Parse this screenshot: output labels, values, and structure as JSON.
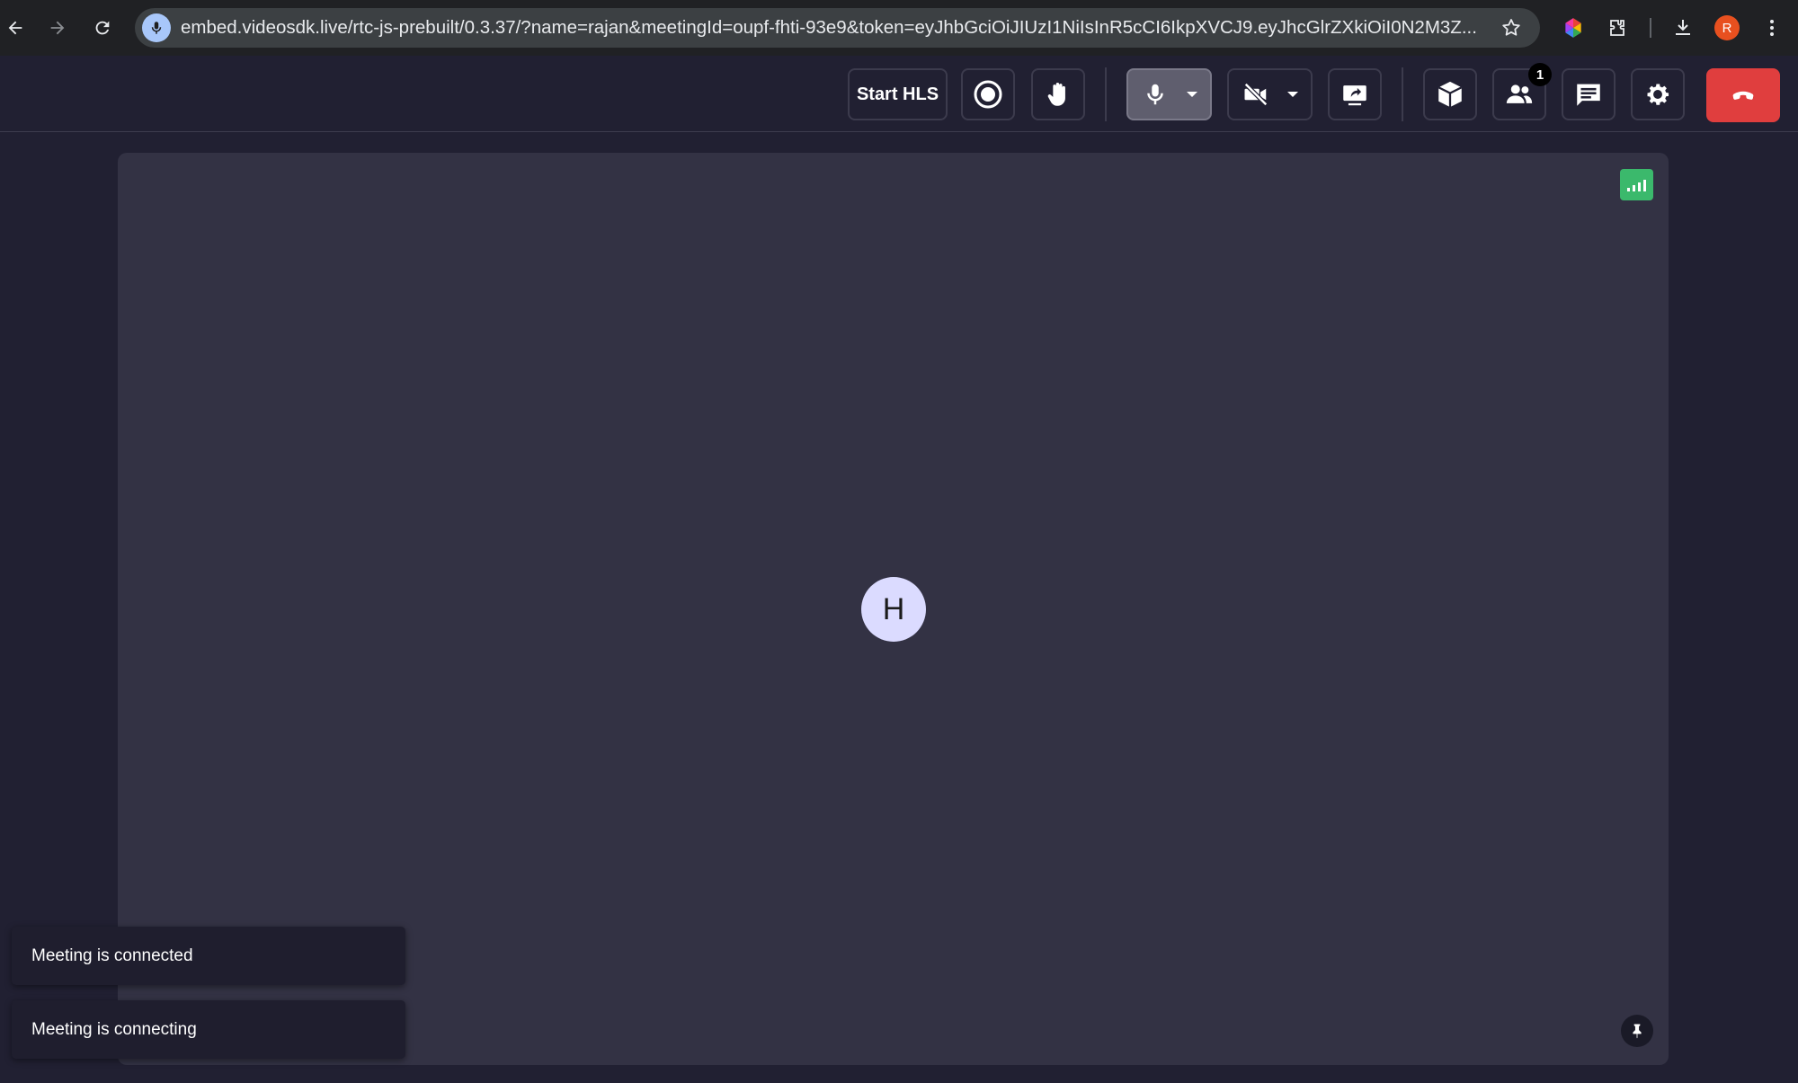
{
  "browser": {
    "url": "embed.videosdk.live/rtc-js-prebuilt/0.3.37/?name=rajan&meetingId=oupf-fhti-93e9&token=eyJhbGciOiJIUzI1NiIsInR5cCI6IkpXVCJ9.eyJhcGlrZXkiOiI0N2M3Z...",
    "profile_initial": "R"
  },
  "topbar": {
    "start_hls_label": "Start HLS",
    "participants_count": "1"
  },
  "tile": {
    "avatar_initial": "H"
  },
  "toasts": [
    {
      "text": "Meeting is connected"
    },
    {
      "text": "Meeting is connecting"
    }
  ],
  "colors": {
    "background": "#212032",
    "tile": "#333244",
    "leave": "#e03e3e",
    "network_good": "#3bb96c",
    "avatar": "#dbdbff"
  },
  "icons": [
    "back-icon",
    "forward-icon",
    "reload-icon",
    "mic-permission-icon",
    "star-icon",
    "color-wheel-icon",
    "extension-icon",
    "download-icon",
    "more-vert-icon",
    "record-icon",
    "raise-hand-icon",
    "mic-icon",
    "video-off-icon",
    "screen-share-icon",
    "cube-icon",
    "participants-icon",
    "chat-icon",
    "settings-icon",
    "end-call-icon",
    "network-icon",
    "pin-icon"
  ]
}
